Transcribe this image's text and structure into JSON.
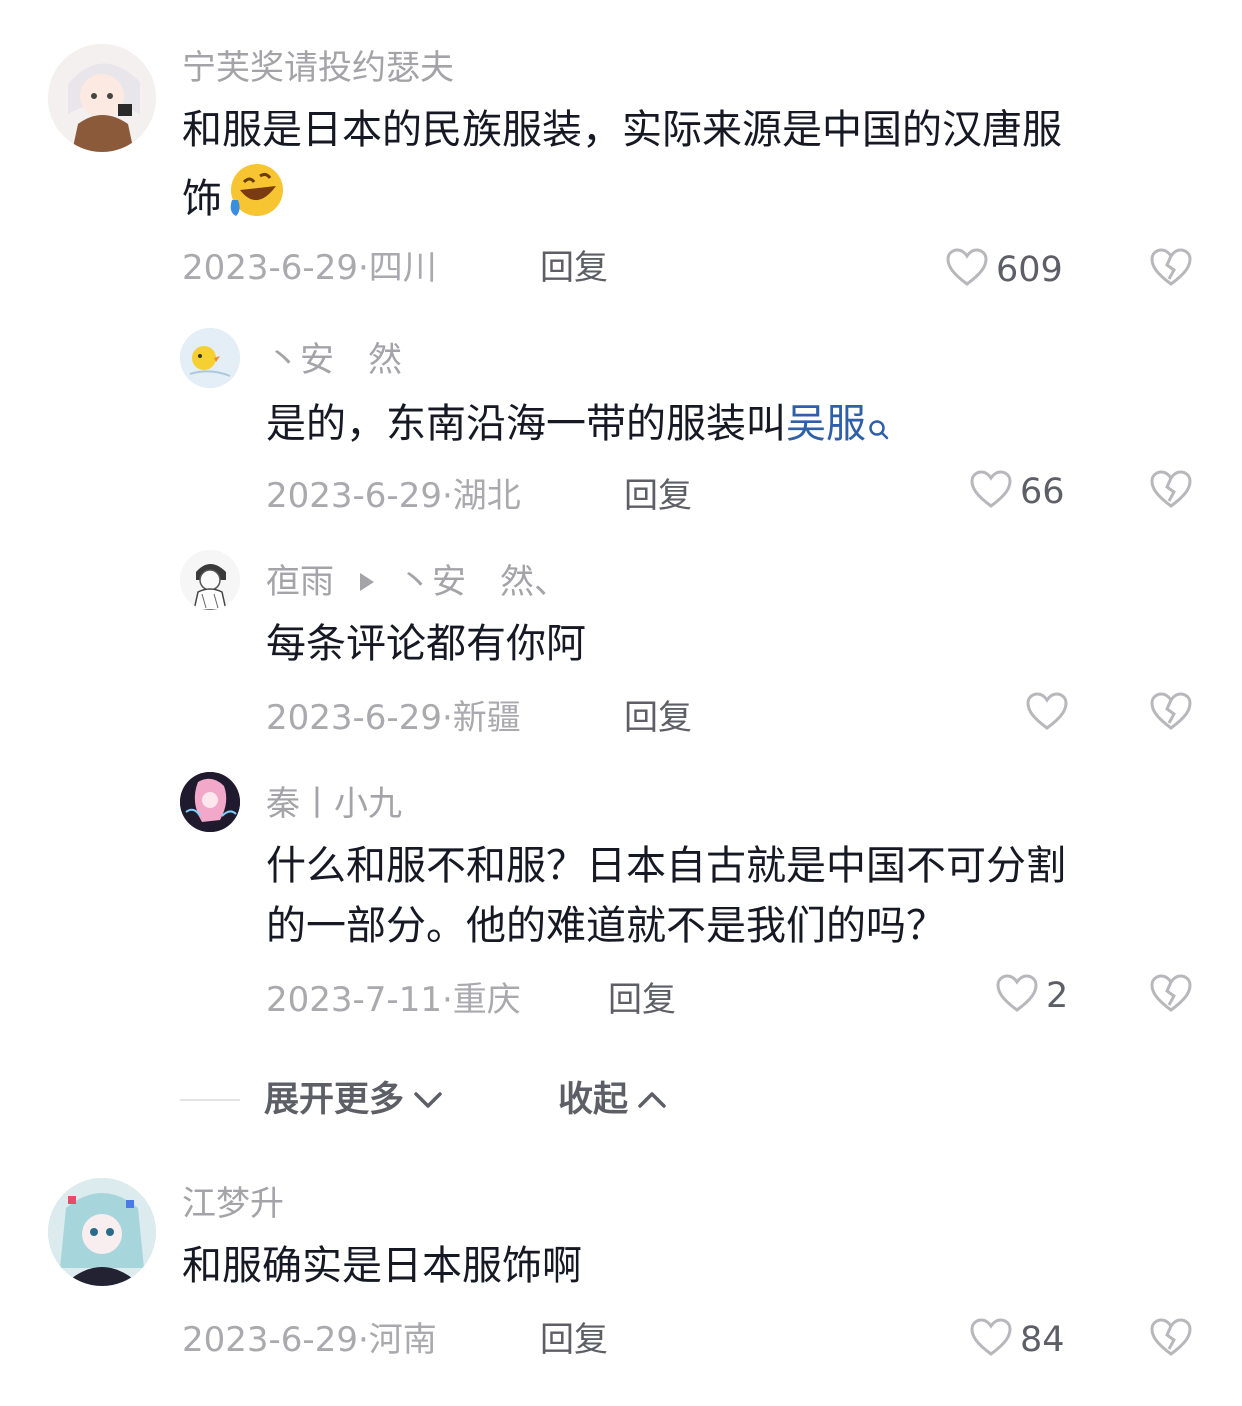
{
  "comments": [
    {
      "username": "宁芙奖请投约瑟夫",
      "content": "和服是日本的民族服装，实际来源是中国的汉唐服饰",
      "content_line1": "和服是日本的民族服装，实际来源是中国的汉唐服",
      "content_line2": "饰",
      "emoji": "rolling-on-floor-laughing-icon",
      "date": "2023-6-29",
      "dot": "·",
      "location": "四川",
      "reply_label": "回复",
      "likes": "609"
    },
    {
      "username": "丶安　然",
      "content_text": "是的，东南沿海一带的服装叫",
      "link_text": "吴服",
      "date": "2023-6-29",
      "dot": "·",
      "location": "湖北",
      "reply_label": "回复",
      "likes": "66"
    },
    {
      "username": "亱雨",
      "reply_to": "丶安　然、",
      "content": "每条评论都有你阿",
      "date": "2023-6-29",
      "dot": "·",
      "location": "新疆",
      "reply_label": "回复",
      "likes": ""
    },
    {
      "username": "秦丨小九",
      "content": "什么和服不和服？日本自古就是中国不可分割的一部分。他的难道就不是我们的吗？",
      "content_line1": "什么和服不和服？日本自古就是中国不可分割",
      "content_line2": "的一部分。他的难道就不是我们的吗？",
      "date": "2023-7-11",
      "dot": "·",
      "location": "重庆",
      "reply_label": "回复",
      "likes": "2"
    },
    {
      "username": "江梦升",
      "content": "和服确实是日本服饰啊",
      "date": "2023-6-29",
      "dot": "·",
      "location": "河南",
      "reply_label": "回复",
      "likes": "84"
    }
  ],
  "thread_controls": {
    "expand_label": "展开更多",
    "collapse_label": "收起"
  },
  "colors": {
    "text": "#161823",
    "muted": "#a9a9ae",
    "link": "#2f5fa8",
    "icon": "#b8b8bc"
  }
}
